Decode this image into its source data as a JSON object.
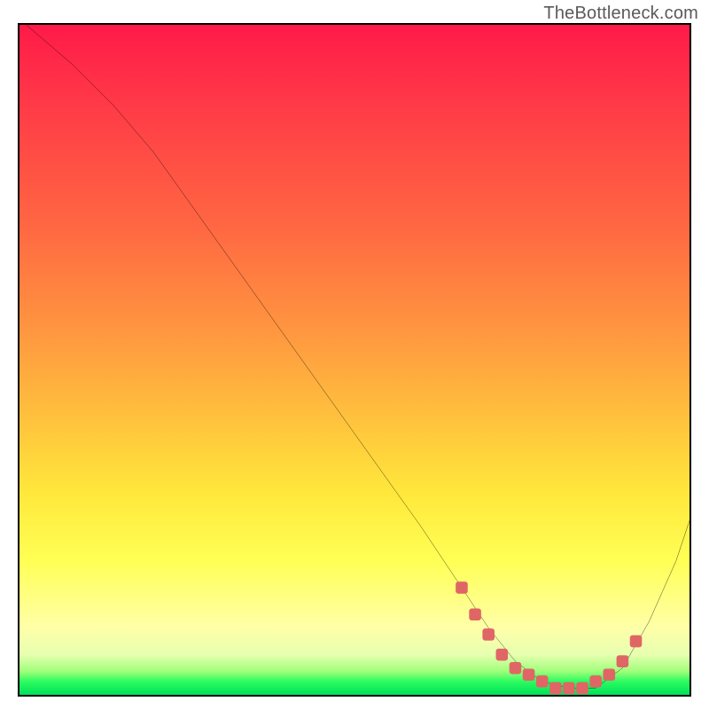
{
  "watermark": "TheBottleneck.com",
  "chart_data": {
    "type": "line",
    "title": "",
    "xlabel": "",
    "ylabel": "",
    "xlim": [
      0,
      100
    ],
    "ylim": [
      0,
      100
    ],
    "grid": false,
    "legend": false,
    "background_gradient": {
      "stops": [
        {
          "pos": 0,
          "color": "#ff1a48"
        },
        {
          "pos": 0.3,
          "color": "#ff6742"
        },
        {
          "pos": 0.58,
          "color": "#ffbf3d"
        },
        {
          "pos": 0.8,
          "color": "#ffff55"
        },
        {
          "pos": 0.94,
          "color": "#e7ffb0"
        },
        {
          "pos": 1.0,
          "color": "#00e15a"
        }
      ]
    },
    "series": [
      {
        "name": "curve-black",
        "color": "#000000",
        "x": [
          1,
          8,
          14,
          20,
          30,
          40,
          50,
          60,
          66,
          70,
          74,
          78,
          82,
          86,
          90,
          94,
          98,
          100
        ],
        "values": [
          100,
          94,
          88,
          81,
          67,
          53,
          39,
          25,
          16,
          10,
          5,
          2,
          1,
          1,
          4,
          11,
          20,
          26
        ]
      },
      {
        "name": "highlight-markers",
        "color": "#e06666",
        "x": [
          66,
          68,
          70,
          72,
          74,
          76,
          78,
          80,
          82,
          84,
          86,
          88,
          90,
          92
        ],
        "values": [
          16,
          12,
          9,
          6,
          4,
          3,
          2,
          1,
          1,
          1,
          2,
          3,
          5,
          8
        ]
      }
    ]
  }
}
